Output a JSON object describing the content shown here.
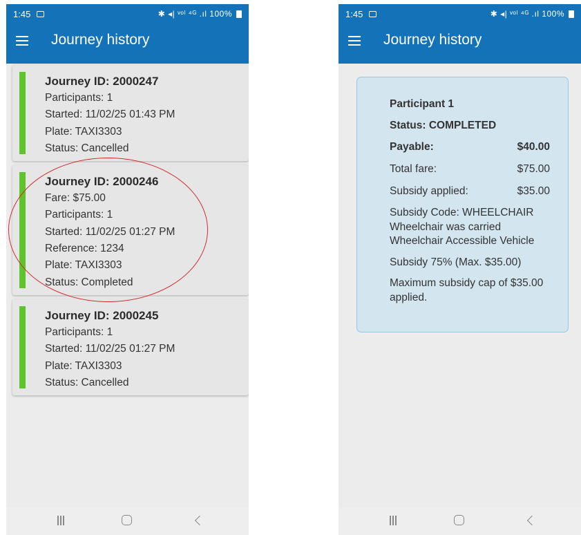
{
  "colors": {
    "app_bar": "#1473b8",
    "status_completed": "#5fc32b",
    "card_background": "#e6e6e6",
    "detail_background": "#d3e5ef",
    "highlight_circle": "#d42a2a"
  },
  "status_bar": {
    "time": "1:45",
    "indicators": "✱ ◂| ᵛᵒˡ ⁴ᴳ .ıl",
    "battery": "100%",
    "icons": [
      "image-icon",
      "bluetooth-icon",
      "mute-icon",
      "volte-icon",
      "signal-icon",
      "battery-icon"
    ]
  },
  "left_screen": {
    "title": "Journey history",
    "journeys": [
      {
        "title": "Journey ID: 2000247",
        "lines": [
          "Participants: 1",
          "Started: 11/02/25 01:43 PM",
          "Plate: TAXI3303",
          "Status: Cancelled"
        ]
      },
      {
        "title": "Journey ID: 2000246",
        "lines": [
          "Fare: $75.00",
          "Participants: 1",
          "Started: 11/02/25 01:27 PM",
          "Reference: 1234",
          "Plate: TAXI3303",
          "Status: Completed"
        ]
      },
      {
        "title": "Journey ID: 2000245",
        "lines": [
          "Participants: 1",
          "Started: 11/02/25 01:27 PM",
          "Plate: TAXI3303",
          "Status: Cancelled"
        ]
      }
    ]
  },
  "right_screen": {
    "title": "Journey history",
    "detail": {
      "participant": "Participant 1",
      "status": "Status: COMPLETED",
      "payable_label": "Payable:",
      "payable_value": "$40.00",
      "total_fare_label": "Total fare:",
      "total_fare_value": "$75.00",
      "subsidy_applied_label": "Subsidy applied:",
      "subsidy_applied_value": "$35.00",
      "subsidy_code": "Subsidy Code: WHEELCHAIR",
      "subsidy_note_1": "Wheelchair was carried",
      "subsidy_note_2": "Wheelchair Accessible Vehicle",
      "subsidy_rate": "Subsidy 75% (Max. $35.00)",
      "subsidy_cap_note": "Maximum subsidy cap of $35.00 applied."
    }
  },
  "nav_bar": {
    "icons": [
      "recent-apps-icon",
      "home-icon",
      "back-icon"
    ]
  }
}
